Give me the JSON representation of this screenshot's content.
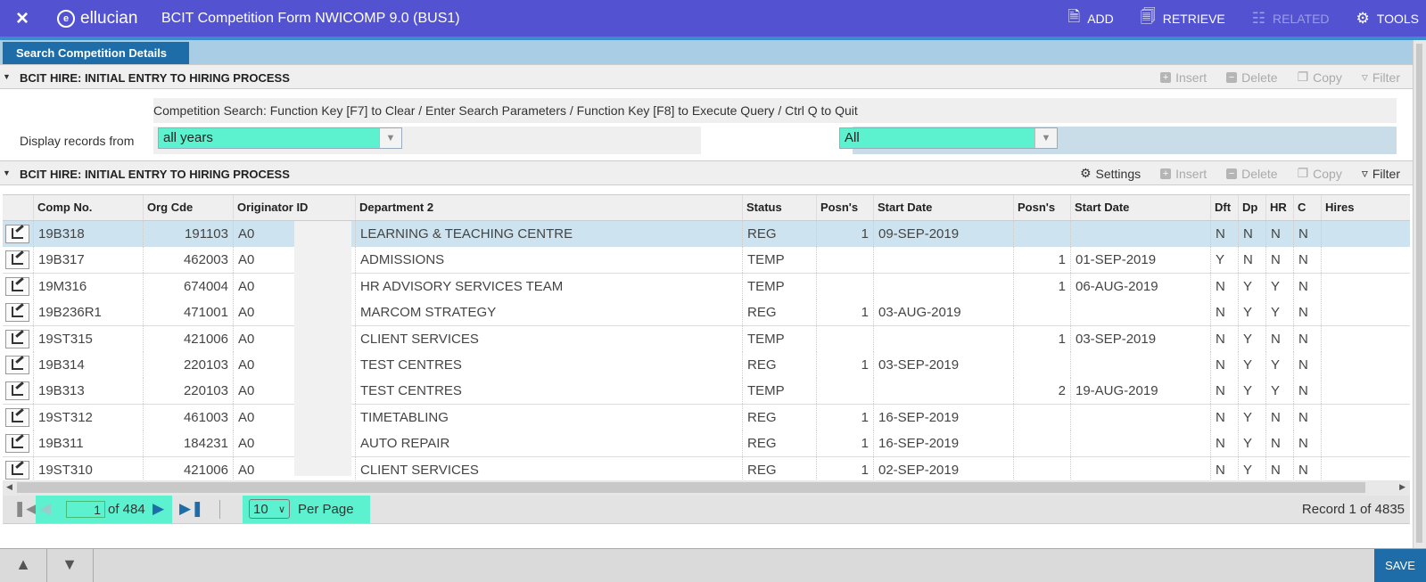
{
  "header": {
    "close_icon": "×",
    "brand": "ellucian",
    "title": "BCIT Competition Form NWICOMP 9.0 (BUS1)",
    "actions": [
      {
        "label": "ADD",
        "icon": "add-icon"
      },
      {
        "label": "RETRIEVE",
        "icon": "retrieve-icon"
      },
      {
        "label": "RELATED",
        "icon": "related-icon"
      },
      {
        "label": "TOOLS",
        "icon": "gear-icon"
      }
    ]
  },
  "tab": {
    "label": "Search Competition Details"
  },
  "section1": {
    "title": "BCIT HIRE: INITIAL ENTRY TO HIRING PROCESS",
    "tools": [
      "Insert",
      "Delete",
      "Copy",
      "Filter"
    ]
  },
  "search": {
    "instructions": "Competition Search: Function Key [F7] to Clear / Enter Search Parameters / Function Key [F8] to Execute Query / Ctrl Q to Quit",
    "display_label": "Display records from",
    "years_value": "all years",
    "status_value": "All"
  },
  "section2": {
    "title": "BCIT HIRE: INITIAL ENTRY TO HIRING PROCESS",
    "settings": "Settings",
    "tools": [
      "Insert",
      "Delete",
      "Copy",
      "Filter"
    ]
  },
  "table": {
    "columns": [
      "Comp No.",
      "Org Cde",
      "Originator ID",
      "Department 2",
      "Status",
      "Posn's",
      "Start Date",
      "Posn's",
      "Start Date",
      "Dft",
      "Dp",
      "HR",
      "C",
      "Hires"
    ],
    "rows": [
      [
        "19B318",
        "191103",
        "A0",
        "LEARNING & TEACHING CENTRE",
        "REG",
        "1",
        "09-SEP-2019",
        "",
        "",
        "N",
        "N",
        "N",
        "N",
        ""
      ],
      [
        "19B317",
        "462003",
        "A0",
        "ADMISSIONS",
        "TEMP",
        "",
        "",
        "1",
        "01-SEP-2019",
        "Y",
        "N",
        "N",
        "N",
        ""
      ],
      [
        "19M316",
        "674004",
        "A0",
        "HR ADVISORY SERVICES TEAM",
        "TEMP",
        "",
        "",
        "1",
        "06-AUG-2019",
        "N",
        "Y",
        "Y",
        "N",
        ""
      ],
      [
        "19B236R1",
        "471001",
        "A0",
        "MARCOM STRATEGY",
        "REG",
        "1",
        "03-AUG-2019",
        "",
        "",
        "N",
        "Y",
        "Y",
        "N",
        ""
      ],
      [
        "19ST315",
        "421006",
        "A0",
        "CLIENT SERVICES",
        "TEMP",
        "",
        "",
        "1",
        "03-SEP-2019",
        "N",
        "Y",
        "N",
        "N",
        ""
      ],
      [
        "19B314",
        "220103",
        "A0",
        "TEST CENTRES",
        "REG",
        "1",
        "03-SEP-2019",
        "",
        "",
        "N",
        "Y",
        "Y",
        "N",
        ""
      ],
      [
        "19B313",
        "220103",
        "A0",
        "TEST CENTRES",
        "TEMP",
        "",
        "",
        "2",
        "19-AUG-2019",
        "N",
        "Y",
        "Y",
        "N",
        ""
      ],
      [
        "19ST312",
        "461003",
        "A0",
        "TIMETABLING",
        "REG",
        "1",
        "16-SEP-2019",
        "",
        "",
        "N",
        "Y",
        "N",
        "N",
        ""
      ],
      [
        "19B311",
        "184231",
        "A0",
        "AUTO REPAIR",
        "REG",
        "1",
        "16-SEP-2019",
        "",
        "",
        "N",
        "Y",
        "N",
        "N",
        ""
      ],
      [
        "19ST310",
        "421006",
        "A0",
        "CLIENT SERVICES",
        "REG",
        "1",
        "02-SEP-2019",
        "",
        "",
        "N",
        "Y",
        "N",
        "N",
        ""
      ]
    ]
  },
  "pager": {
    "page": "1",
    "of_text": "of 484",
    "per_page": "10",
    "per_page_label": "Per Page",
    "record_text": "Record 1 of 4835"
  },
  "footer": {
    "save_label": "SAVE"
  }
}
